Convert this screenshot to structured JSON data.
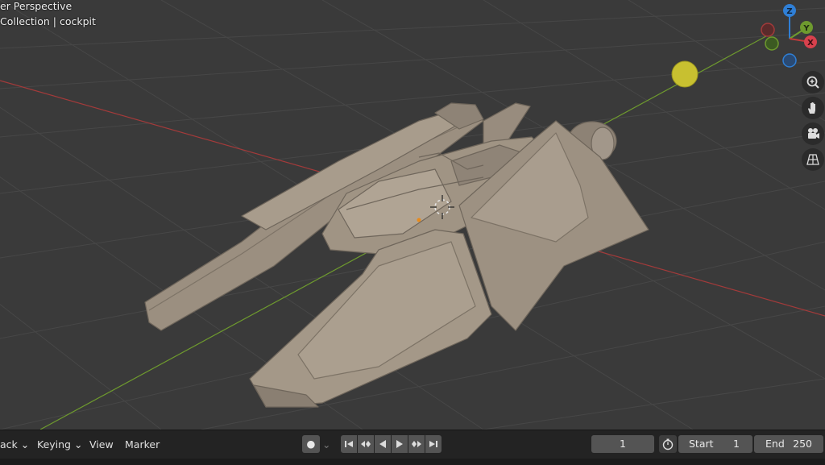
{
  "viewport": {
    "view_name": "er Perspective",
    "collection_info": "Collection | cockpit",
    "gizmo_axes": [
      "Z",
      "Y",
      "X"
    ],
    "tools": [
      {
        "name": "zoom-icon"
      },
      {
        "name": "pan-hand-icon"
      },
      {
        "name": "camera-icon"
      },
      {
        "name": "grid-perspective-icon"
      }
    ]
  },
  "timeline": {
    "menu_track": "ack",
    "menu_keying": "Keying",
    "menu_view": "View",
    "menu_marker": "Marker",
    "current_frame": "1",
    "start_label": "Start",
    "start_value": "1",
    "end_label": "End",
    "end_value": "250"
  },
  "colors": {
    "viewport_bg": "#3a3a3a",
    "x_axis": "#a33a3a",
    "y_axis": "#6e9a2e",
    "z_axis": "#2f7fd6",
    "model": "#9e9283",
    "light": "#c8c030"
  }
}
